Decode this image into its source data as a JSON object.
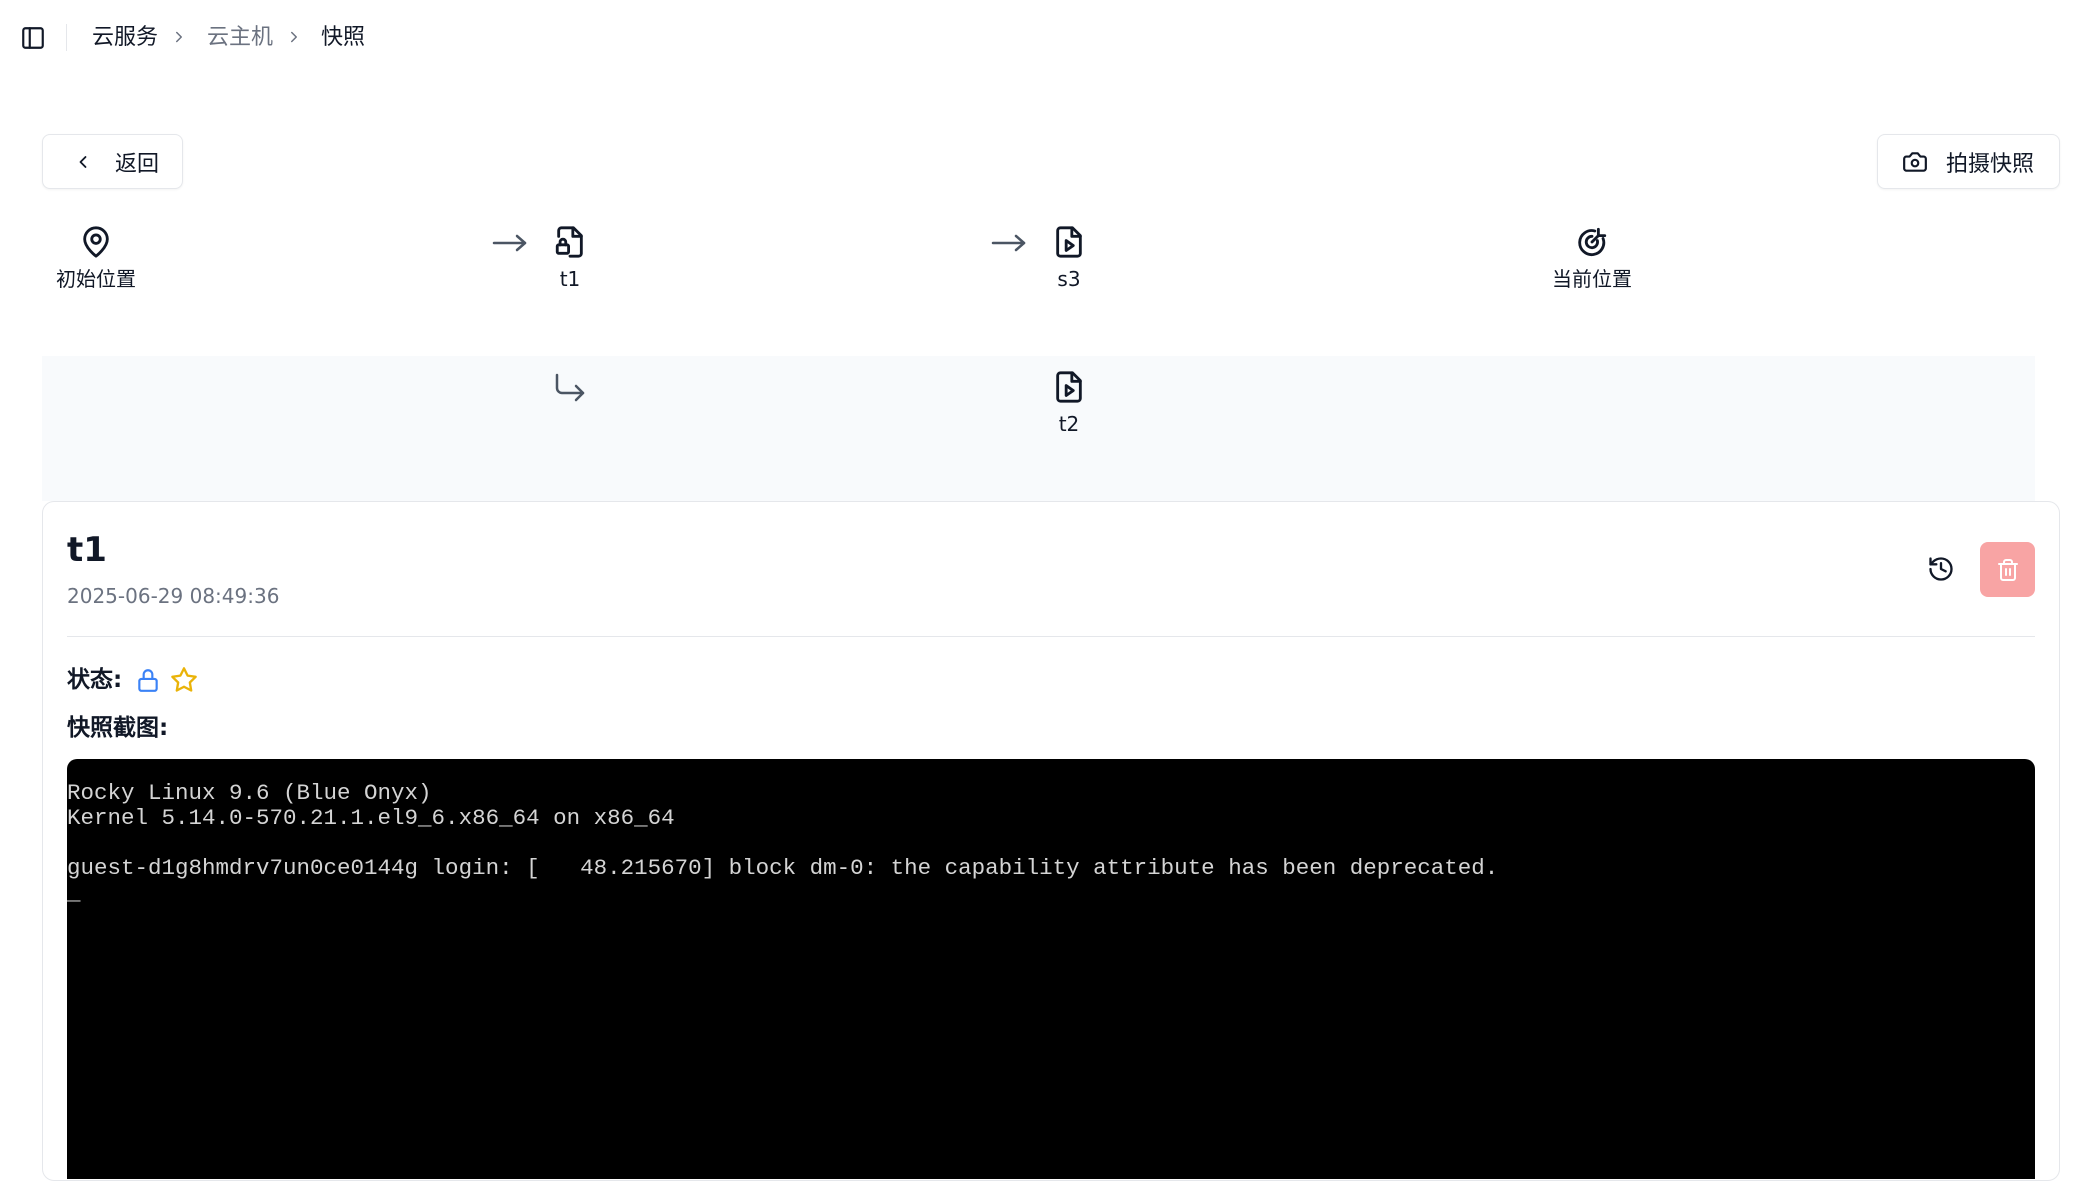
{
  "breadcrumb": {
    "items": [
      "云服务",
      "云主机",
      "快照"
    ]
  },
  "toolbar": {
    "back_label": "返回",
    "take_snapshot_label": "拍摄快照"
  },
  "snapshot_tree": {
    "main_branch": [
      {
        "label": "初始位置",
        "icon": "map-pin-icon"
      },
      {
        "label": "t1",
        "icon": "file-lock-icon"
      },
      {
        "label": "s3",
        "icon": "file-play-icon"
      },
      {
        "label": "当前位置",
        "icon": "target-icon"
      }
    ],
    "sub_branch": [
      {
        "label": "t2",
        "icon": "file-play-icon"
      }
    ]
  },
  "detail": {
    "title": "t1",
    "date": "2025-06-29 08:49:36",
    "status_label": "状态:",
    "screenshot_label": "快照截图:",
    "colors": {
      "lock": "#3b82f6",
      "star": "#eab308",
      "delete_bg": "#f8a4a4"
    }
  },
  "terminal": {
    "lines": [
      "Rocky Linux 9.6 (Blue Onyx)",
      "Kernel 5.14.0-570.21.1.el9_6.x86_64 on x86_64",
      "",
      "guest-d1g8hmdrv7un0ce0144g login: [   48.215670] block dm-0: the capability attribute has been deprecated.",
      "_"
    ]
  }
}
